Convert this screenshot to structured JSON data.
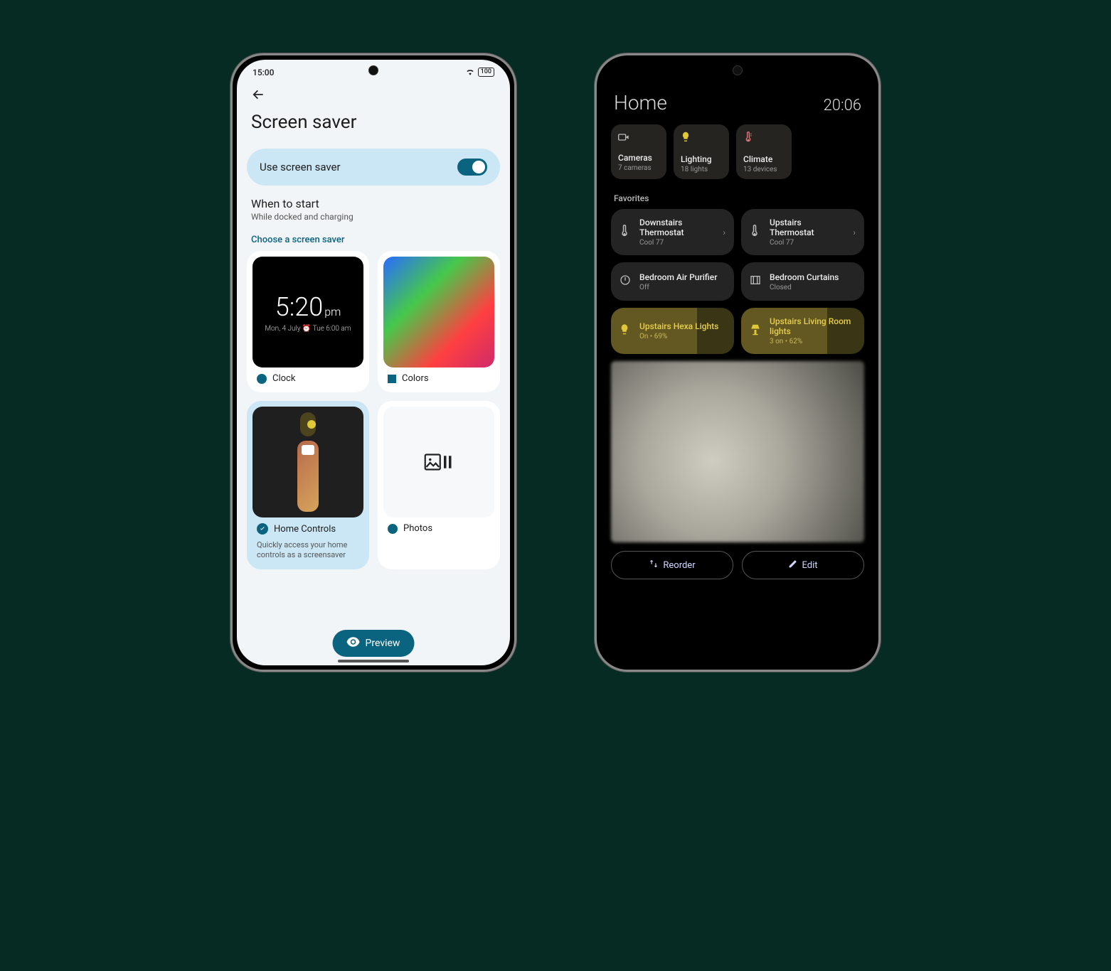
{
  "phoneA": {
    "statusbar": {
      "time": "15:00",
      "battery": "100"
    },
    "title": "Screen saver",
    "toggle_label": "Use screen saver",
    "when_to_start_title": "When to start",
    "when_to_start_sub": "While docked and charging",
    "choose_label": "Choose a screen saver",
    "options": [
      {
        "label": "Clock",
        "thumb_time": "5:20",
        "thumb_ampm": "pm",
        "thumb_sub": "Mon, 4 July ⏰ Tue 6:00 am"
      },
      {
        "label": "Colors"
      },
      {
        "label": "Home Controls",
        "desc": "Quickly access your home controls as a screensaver",
        "selected": true
      },
      {
        "label": "Photos"
      }
    ],
    "preview_label": "Preview"
  },
  "phoneB": {
    "title": "Home",
    "time": "20:06",
    "categories": [
      {
        "name": "Cameras",
        "count": "7 cameras",
        "icon": "cam"
      },
      {
        "name": "Lighting",
        "count": "18 lights",
        "icon": "bulb"
      },
      {
        "name": "Climate",
        "count": "13 devices",
        "icon": "therm"
      }
    ],
    "favorites_label": "Favorites",
    "devices": [
      {
        "name": "Downstairs Thermostat",
        "sub": "Cool 77",
        "icon": "therm",
        "chev": true
      },
      {
        "name": "Upstairs Thermostat",
        "sub": "Cool 77",
        "icon": "therm",
        "chev": true
      },
      {
        "name": "Bedroom Air Purifier",
        "sub": "Off",
        "icon": "power"
      },
      {
        "name": "Bedroom Curtains",
        "sub": "Closed",
        "icon": "curtain"
      },
      {
        "name": "Upstairs Hexa Lights",
        "sub": "On • 69%",
        "icon": "bulb",
        "lit": true
      },
      {
        "name": "Upstairs Living Room lights",
        "sub": "3 on • 62%",
        "icon": "lamp",
        "lit": true
      }
    ],
    "reorder_label": "Reorder",
    "edit_label": "Edit"
  }
}
